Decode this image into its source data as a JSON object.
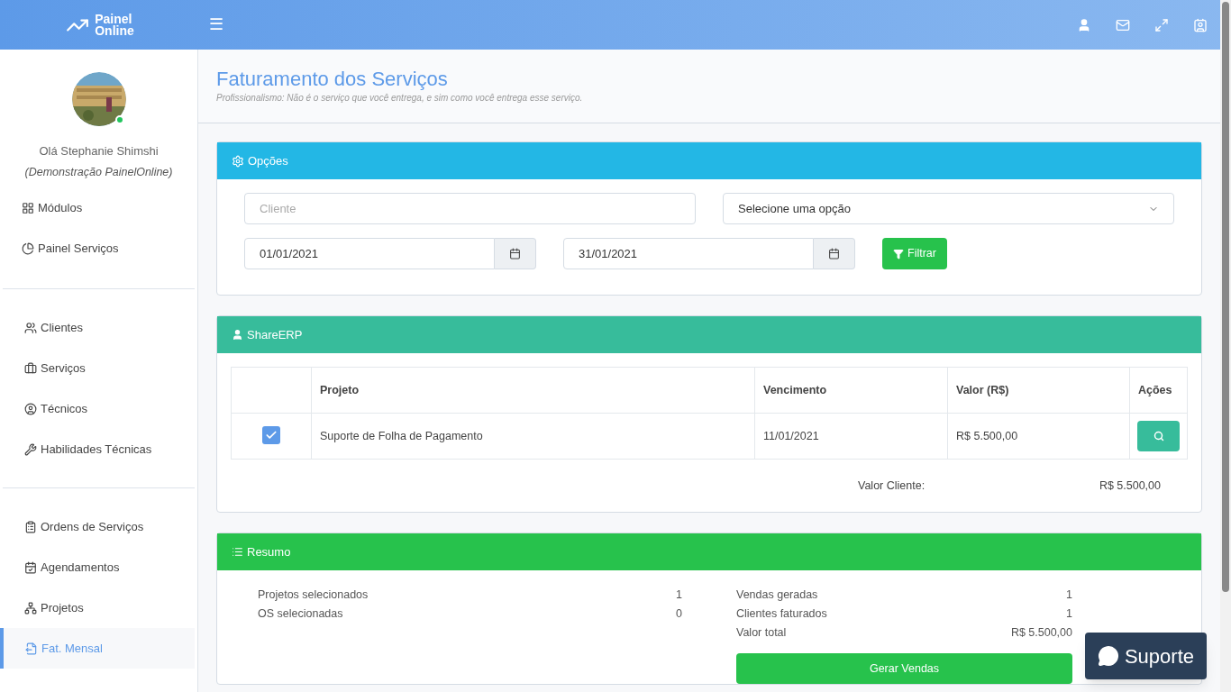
{
  "header": {
    "logo_line1": "Painel",
    "logo_line2": "Online",
    "menu_glyph": "☰"
  },
  "user": {
    "greeting": "Olá Stephanie Shimshi",
    "subtitle": "(Demonstração PainelOnline)",
    "online": true
  },
  "sidebar": {
    "groups": [
      [
        {
          "label": "Módulos",
          "selected": false
        },
        {
          "label": "Painel Serviços",
          "selected": false
        }
      ],
      [
        {
          "label": "Clientes",
          "selected": false
        },
        {
          "label": "Serviços",
          "selected": false
        },
        {
          "label": "Técnicos",
          "selected": false
        },
        {
          "label": "Habilidades Técnicas",
          "selected": false
        }
      ],
      [
        {
          "label": "Ordens de Serviços",
          "selected": false
        },
        {
          "label": "Agendamentos",
          "selected": false
        },
        {
          "label": "Projetos",
          "selected": false
        },
        {
          "label": "Fat. Mensal",
          "selected": true
        }
      ]
    ]
  },
  "page": {
    "title": "Faturamento dos Serviços",
    "subtitle": "Profissionalismo: Não é o serviço que você entrega, e sim como você entrega esse serviço."
  },
  "options": {
    "title": "Opções",
    "client": {
      "placeholder": "Cliente"
    },
    "select": {
      "value": "Selecione uma opção"
    },
    "date_from": {
      "value": "01/01/2021"
    },
    "date_to": {
      "value": "31/01/2021"
    },
    "filter_button": "Filtrar"
  },
  "client_panel": {
    "title": "ShareERP",
    "columns": [
      "Projeto",
      "Vencimento",
      "Valor (R$)",
      "Ações"
    ],
    "rows": [
      {
        "checked": true,
        "project": "Suporte de Folha de Pagamento",
        "due": "11/01/2021",
        "value": "R$ 5.500,00"
      }
    ],
    "total_label": "Valor Cliente:",
    "total_value": "R$ 5.500,00"
  },
  "summary": {
    "title": "Resumo",
    "left": [
      {
        "label": "Projetos selecionados",
        "value": "1"
      },
      {
        "label": "OS selecionadas",
        "value": "0"
      }
    ],
    "right": [
      {
        "label": "Vendas geradas",
        "value": "1"
      },
      {
        "label": "Clientes faturados",
        "value": "1"
      },
      {
        "label": "Valor total",
        "value": "R$ 5.500,00"
      }
    ],
    "button": "Gerar Vendas"
  },
  "support_button": "Suporte"
}
